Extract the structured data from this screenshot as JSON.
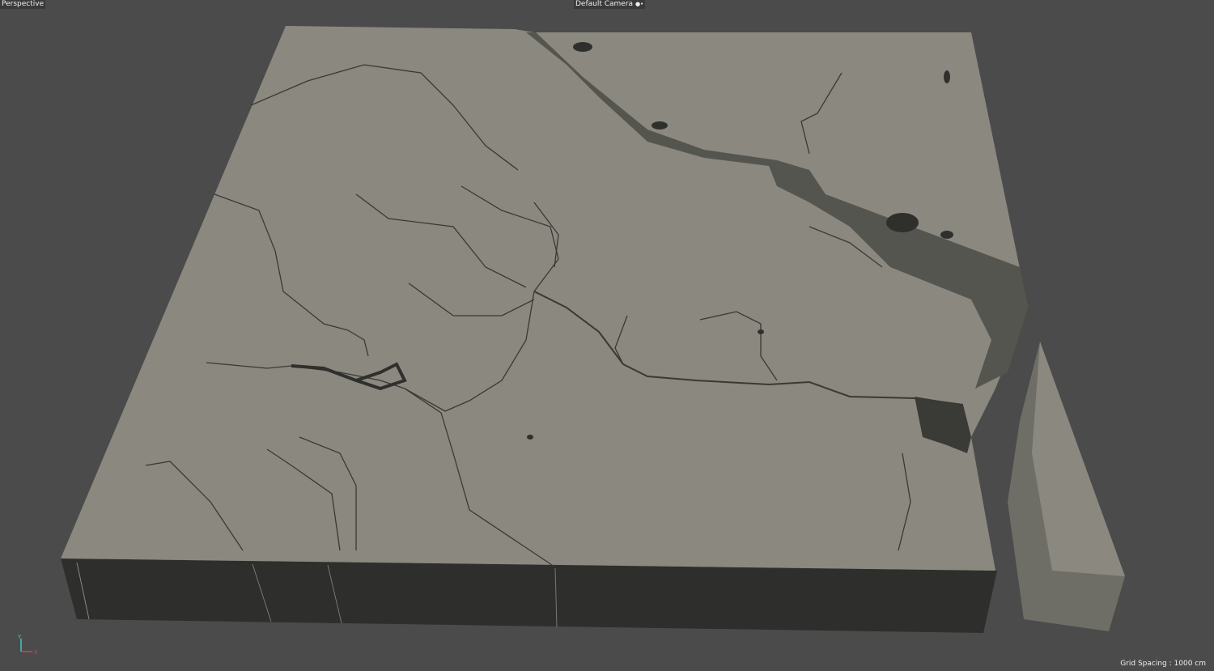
{
  "viewport": {
    "view_name": "Perspective",
    "camera_name": "Default Camera",
    "camera_icon": "camera-icon",
    "grid_spacing": "Grid Spacing : 1000 cm",
    "axis": {
      "y_label": "Y",
      "x_label": "X"
    }
  },
  "colors": {
    "background": "#4b4b4b",
    "terrain_top": "#8a887f",
    "terrain_side": "#2f2f2d",
    "river": "#3a3935",
    "axis_y": "#3fc8c0",
    "axis_x": "#d0445a"
  }
}
